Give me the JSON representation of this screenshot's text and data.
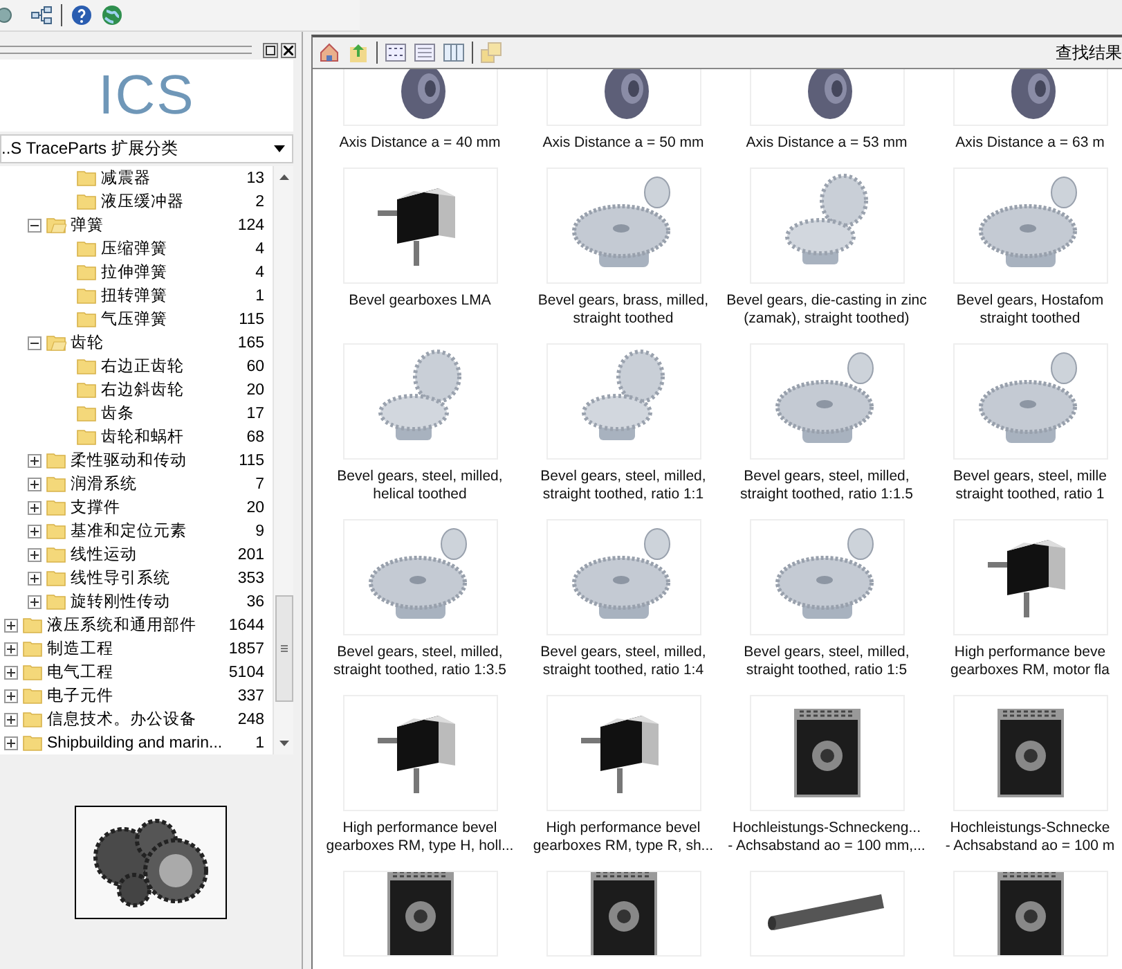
{
  "left_panel": {
    "logo": "ICS",
    "dropdown": {
      "value": "..S TraceParts 扩展分类"
    },
    "tree": [
      {
        "children": [
          {
            "children": [
              {
                "label": "减震器",
                "count": "13"
              },
              {
                "label": "液压缓冲器",
                "count": "2"
              }
            ]
          },
          {
            "label": "弹簧",
            "count": "124",
            "expanded": true,
            "children": [
              {
                "label": "压缩弹簧",
                "count": "4"
              },
              {
                "label": "拉伸弹簧",
                "count": "4"
              },
              {
                "label": "扭转弹簧",
                "count": "1"
              },
              {
                "label": "气压弹簧",
                "count": "115"
              }
            ]
          },
          {
            "label": "齿轮",
            "count": "165",
            "expanded": true,
            "children": [
              {
                "label": "右边正齿轮",
                "count": "60"
              },
              {
                "label": "右边斜齿轮",
                "count": "20"
              },
              {
                "label": "齿条",
                "count": "17"
              },
              {
                "label": "齿轮和蜗杆",
                "count": "68"
              }
            ]
          },
          {
            "label": "柔性驱动和传动",
            "count": "115",
            "expanded": false
          },
          {
            "label": "润滑系统",
            "count": "7",
            "expanded": false
          },
          {
            "label": "支撑件",
            "count": "20",
            "expanded": false
          },
          {
            "label": "基准和定位元素",
            "count": "9",
            "expanded": false
          },
          {
            "label": "线性运动",
            "count": "201",
            "expanded": false
          },
          {
            "label": "线性导引系统",
            "count": "353",
            "expanded": false
          },
          {
            "label": "旋转刚性传动",
            "count": "36",
            "expanded": false
          }
        ]
      },
      {
        "label": "液压系统和通用部件",
        "count": "1644",
        "expanded": false
      },
      {
        "label": "制造工程",
        "count": "1857",
        "expanded": false
      },
      {
        "label": "电气工程",
        "count": "5104",
        "expanded": false
      },
      {
        "label": "电子元件",
        "count": "337",
        "expanded": false
      },
      {
        "label": "信息技术。办公设备",
        "count": "248",
        "expanded": false
      },
      {
        "label": "Shipbuilding and marin...",
        "count": "1",
        "expanded": false
      }
    ]
  },
  "results": {
    "title": "查找结果",
    "rows": [
      {
        "items": [
          {
            "kind": "worm-wheel",
            "lines": [
              "Axis Distance a = 40 mm"
            ]
          },
          {
            "kind": "worm-wheel",
            "lines": [
              "Axis Distance a = 50 mm"
            ]
          },
          {
            "kind": "worm-wheel",
            "lines": [
              "Axis Distance a = 53 mm"
            ]
          },
          {
            "kind": "worm-wheel",
            "lines": [
              "Axis Distance a = 63 m"
            ]
          }
        ]
      },
      {
        "items": [
          {
            "kind": "gearbox",
            "lines": [
              "Bevel gearboxes LMA"
            ]
          },
          {
            "kind": "bevel-gear",
            "lines": [
              "Bevel gears, brass, milled,",
              "straight toothed"
            ]
          },
          {
            "kind": "bevel-pair",
            "lines": [
              "Bevel gears, die-casting in zinc",
              "(zamak), straight toothed)"
            ]
          },
          {
            "kind": "bevel-gear",
            "lines": [
              "Bevel gears, Hostafom",
              "straight toothed"
            ]
          }
        ]
      },
      {
        "items": [
          {
            "kind": "bevel-pair",
            "lines": [
              "Bevel gears, steel, milled,",
              "helical toothed"
            ]
          },
          {
            "kind": "bevel-pair",
            "lines": [
              "Bevel gears, steel, milled,",
              "straight toothed, ratio 1:1"
            ]
          },
          {
            "kind": "bevel-gear",
            "lines": [
              "Bevel gears, steel, milled,",
              "straight toothed, ratio 1:1.5"
            ]
          },
          {
            "kind": "bevel-gear",
            "lines": [
              "Bevel gears, steel, mille",
              "straight toothed, ratio 1"
            ]
          }
        ]
      },
      {
        "items": [
          {
            "kind": "bevel-gear",
            "lines": [
              "Bevel gears, steel, milled,",
              "straight toothed, ratio 1:3.5"
            ]
          },
          {
            "kind": "bevel-gear",
            "lines": [
              "Bevel gears, steel, milled,",
              "straight toothed, ratio 1:4"
            ]
          },
          {
            "kind": "bevel-gear",
            "lines": [
              "Bevel gears, steel, milled,",
              "straight toothed, ratio 1:5"
            ]
          },
          {
            "kind": "gearbox",
            "lines": [
              "High performance beve",
              "gearboxes RM, motor fla"
            ]
          }
        ]
      },
      {
        "items": [
          {
            "kind": "gearbox",
            "lines": [
              "High performance bevel",
              "gearboxes RM, type H, holl..."
            ]
          },
          {
            "kind": "gearbox",
            "lines": [
              "High performance bevel",
              "gearboxes RM, type R, sh..."
            ]
          },
          {
            "kind": "worm-gearbox",
            "lines": [
              "Hochleistungs-Schneckeng...",
              "- Achsabstand ao = 100 mm,..."
            ]
          },
          {
            "kind": "worm-gearbox",
            "lines": [
              "Hochleistungs-Schnecke",
              "- Achsabstand ao = 100 m"
            ]
          }
        ]
      },
      {
        "items": [
          {
            "kind": "worm-gearbox"
          },
          {
            "kind": "worm-gearbox"
          },
          {
            "kind": "shaft"
          },
          {
            "kind": "worm-gearbox"
          }
        ]
      }
    ]
  }
}
